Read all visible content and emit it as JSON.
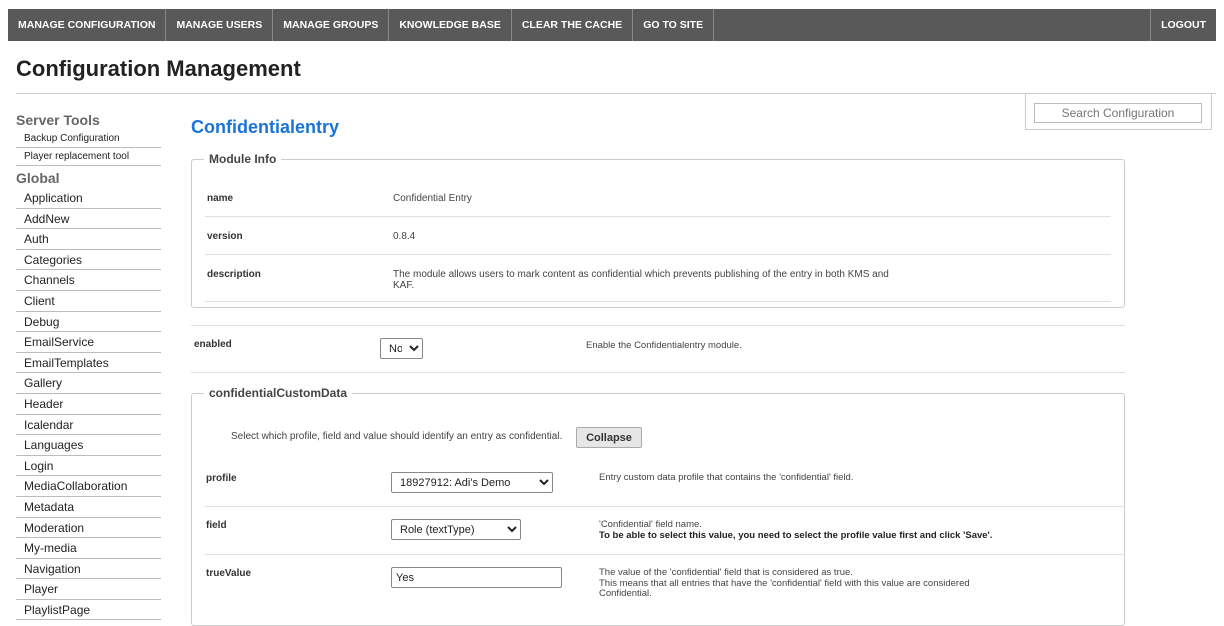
{
  "topnav": {
    "items": [
      "MANAGE CONFIGURATION",
      "MANAGE USERS",
      "MANAGE GROUPS",
      "KNOWLEDGE BASE",
      "CLEAR THE CACHE",
      "GO TO SITE"
    ],
    "logout": "LOGOUT"
  },
  "page_title": "Configuration Management",
  "search": {
    "placeholder": "Search Configuration"
  },
  "sidebar": {
    "server_tools_heading": "Server Tools",
    "server_tools": [
      "Backup Configuration",
      "Player replacement tool"
    ],
    "global_heading": "Global",
    "global_items": [
      "Application",
      "AddNew",
      "Auth",
      "Categories",
      "Channels",
      "Client",
      "Debug",
      "EmailService",
      "EmailTemplates",
      "Gallery",
      "Header",
      "Icalendar",
      "Languages",
      "Login",
      "MediaCollaboration",
      "Metadata",
      "Moderation",
      "My-media",
      "Navigation",
      "Player",
      "PlaylistPage"
    ]
  },
  "module": {
    "title": "Confidentialentry",
    "info_legend": "Module Info",
    "name_label": "name",
    "name_value": "Confidential Entry",
    "version_label": "version",
    "version_value": "0.8.4",
    "description_label": "description",
    "description_value": "The module allows users to mark content as confidential which prevents publishing of the entry in both KMS and KAF."
  },
  "enabled": {
    "label": "enabled",
    "value": "No",
    "description": "Enable the Confidentialentry module."
  },
  "custom_data": {
    "legend": "confidentialCustomData",
    "intro": "Select which profile, field and value should identify an entry as confidential.",
    "collapse_label": "Collapse",
    "profile_label": "profile",
    "profile_value": "18927912: Adi's Demo",
    "profile_desc": "Entry custom data profile that contains the 'confidential' field.",
    "field_label": "field",
    "field_value": "Role (textType)",
    "field_desc_1": "'Confidential' field name.",
    "field_desc_2": "To be able to select this value, you need to select the profile value first and click 'Save'.",
    "truevalue_label": "trueValue",
    "truevalue_value": "Yes",
    "truevalue_desc_1": "The value of the 'confidential' field that is considered as true.",
    "truevalue_desc_2": "This means that all entries that have the 'confidential' field with this value are considered Confidential."
  }
}
